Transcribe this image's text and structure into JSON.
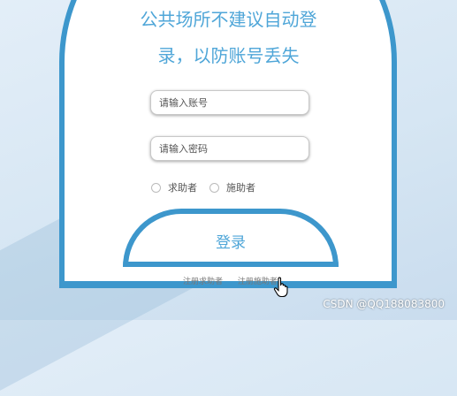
{
  "login": {
    "title_line1": "公共场所不建议自动登",
    "title_line2": "录，以防账号丢失",
    "account_placeholder": "请输入账号",
    "password_placeholder": "请输入密码",
    "role_options": [
      "求助者",
      "施助者"
    ],
    "login_button": "登录",
    "register_seeker": "注册求助者",
    "register_helper": "注册施助者"
  },
  "watermark": "CSDN @QQ188083800",
  "colors": {
    "accent": "#3d97cc",
    "text_accent": "#4fa6d8"
  },
  "icons": [
    "hand-pointer-cursor-icon"
  ]
}
